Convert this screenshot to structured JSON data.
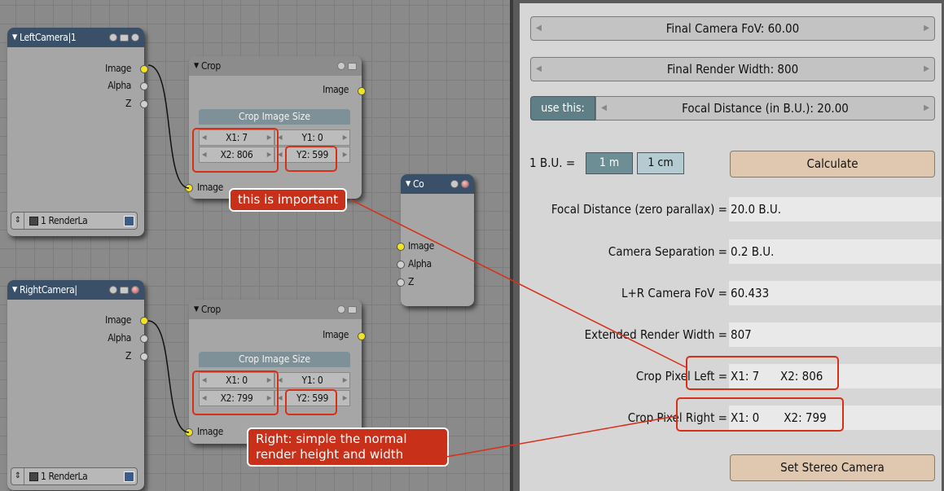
{
  "colors": {
    "accent_red": "#d6301a",
    "callout_bg": "#c9301a",
    "node_bg": "#a6a6a6",
    "socket_yellow": "#f1e422",
    "panel_bg": "#d6d6d6",
    "active_toggle": "#607e86",
    "action_button": "#e0c8b0"
  },
  "nodes": {
    "left_camera": {
      "title": "LeftCamera|1",
      "outputs": [
        "Image",
        "Alpha",
        "Z"
      ],
      "render_layer": "1 RenderLa"
    },
    "right_camera": {
      "title": "RightCamera|",
      "outputs": [
        "Image",
        "Alpha",
        "Z"
      ],
      "render_layer": "1 RenderLa"
    },
    "crop_top": {
      "title": "Crop",
      "output": "Image",
      "section": "Crop Image Size",
      "x1": "X1: 7",
      "y1": "Y1: 0",
      "x2": "X2: 806",
      "y2": "Y2: 599",
      "input": "Image"
    },
    "crop_bottom": {
      "title": "Crop",
      "output": "Image",
      "section": "Crop Image Size",
      "x1": "X1: 0",
      "y1": "Y1: 0",
      "x2": "X2: 799",
      "y2": "Y2: 599",
      "input": "Image"
    },
    "composite": {
      "title": "Co",
      "inputs": [
        "Image",
        "Alpha",
        "Z"
      ]
    }
  },
  "callouts": {
    "important": "this is important",
    "right_line1": "Right: simple the normal",
    "right_line2": "render height and width"
  },
  "panel": {
    "final_fov": "Final Camera FoV: 60.00",
    "final_width": "Final Render Width: 800",
    "use_this": "use this:",
    "focal_distance": "Focal Distance (in B.U.): 20.00",
    "bu_label": "1 B.U. =",
    "unit_m": "1 m",
    "unit_cm": "1 cm",
    "calculate": "Calculate",
    "rows": [
      {
        "label": "Focal Distance (zero parallax) =",
        "value": "20.0 B.U."
      },
      {
        "label": "Camera Separation =",
        "value": "0.2 B.U."
      },
      {
        "label": "L+R Camera FoV =",
        "value": "60.433"
      },
      {
        "label": "Extended Render Width =",
        "value": "807"
      },
      {
        "label": "Crop Pixel Left =",
        "value": "X1: 7      X2: 806"
      },
      {
        "label": "Crop Pixel Right =",
        "value": "X1: 0       X2: 799"
      }
    ],
    "set_stereo": "Set Stereo Camera"
  }
}
